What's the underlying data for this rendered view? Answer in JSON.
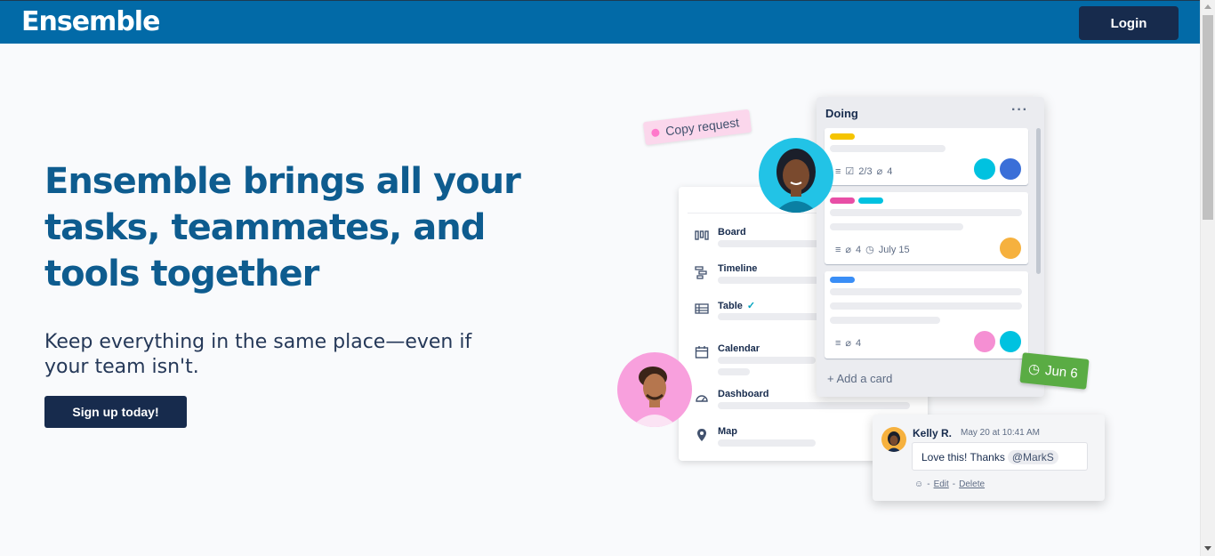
{
  "header": {
    "logo": "Ensemble",
    "login_label": "Login",
    "bg_color": "#026aa7"
  },
  "hero": {
    "headline": "Ensemble brings all your tasks, teammates, and tools together",
    "subheadline": "Keep everything in the same place—even if your team isn't.",
    "cta_label": "Sign up today!"
  },
  "illustration": {
    "tag_label": "Copy request",
    "due_label": "Jun 6",
    "nav_items": [
      {
        "label": "Board",
        "icon": "board-icon"
      },
      {
        "label": "Timeline",
        "icon": "timeline-icon"
      },
      {
        "label": "Table",
        "icon": "table-icon"
      },
      {
        "label": "Calendar",
        "icon": "calendar-icon"
      },
      {
        "label": "Dashboard",
        "icon": "dashboard-icon"
      },
      {
        "label": "Map",
        "icon": "map-pin-icon"
      }
    ],
    "list": {
      "title": "Doing",
      "menu": "···",
      "add_card": "Add a card",
      "cards": [
        {
          "checklist": "2/3",
          "attachments": "4"
        },
        {
          "attachments": "4",
          "due": "July 15"
        },
        {
          "attachments": "4"
        }
      ]
    },
    "comment": {
      "author": "Kelly R.",
      "time": "May 20 at 10:41 AM",
      "text": "Love this! Thanks",
      "mention": "@MarkS",
      "edit": "Edit",
      "delete": "Delete",
      "sep": "-"
    }
  }
}
